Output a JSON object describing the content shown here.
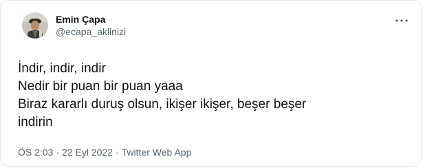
{
  "author": {
    "display_name": "Emin Çapa",
    "handle": "@ecapa_aklinizi",
    "avatar_icon": "user-avatar-photo"
  },
  "more_icon": "more-horizontal-icon",
  "tweet": {
    "lines": [
      "İndir, indir, indir",
      "Nedir bir puan bir puan yaaa",
      "Biraz kararlı duruş olsun, ikişer ikişer, beşer beşer",
      "indirin"
    ]
  },
  "meta": {
    "time": "ÖS 2:03",
    "separator": "·",
    "date": "22 Eyl 2022",
    "source": "Twitter Web App"
  },
  "colors": {
    "text_primary": "#0f1419",
    "text_secondary": "#536471",
    "border": "#e4e9ec"
  }
}
